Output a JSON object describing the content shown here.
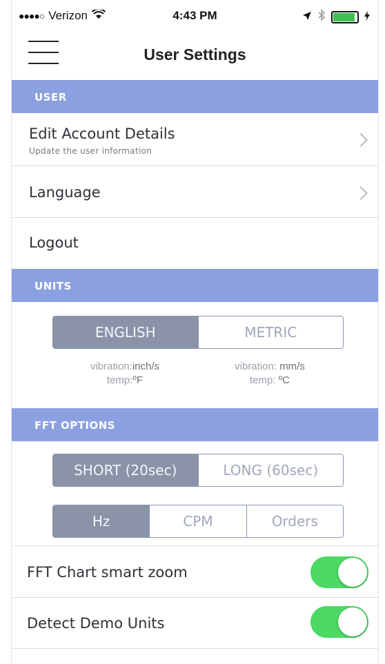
{
  "status_bar": {
    "signal": "●●●●○",
    "carrier": "Verizon",
    "wifi": "wifi-icon",
    "time": "4:43 PM",
    "location": "location-arrow-icon",
    "bluetooth": "bluetooth-icon",
    "battery_charge": 1.0
  },
  "nav": {
    "title": "User Settings",
    "menu_icon": "hamburger-menu-icon"
  },
  "sections": {
    "user": "USER",
    "units": "UNITS",
    "fft": "FFT OPTIONS"
  },
  "user_rows": {
    "edit_account": {
      "label": "Edit Account Details",
      "sub": "Update the user information"
    },
    "language": {
      "label": "Language"
    },
    "logout": {
      "label": "Logout"
    }
  },
  "units": {
    "options": [
      "ENGLISH",
      "METRIC"
    ],
    "selected": "ENGLISH",
    "english_hint": {
      "vib_label": "vibration:",
      "vib_unit": "inch/s",
      "temp_label": "temp:",
      "temp_unit": "ºF"
    },
    "metric_hint": {
      "vib_label": "vibration: ",
      "vib_unit": "mm/s",
      "temp_label": "temp: ",
      "temp_unit": "ºC"
    }
  },
  "fft": {
    "duration_options": [
      "SHORT (20sec)",
      "LONG (60sec)"
    ],
    "duration_selected": "SHORT (20sec)",
    "freq_options": [
      "Hz",
      "CPM",
      "Orders"
    ],
    "freq_selected": "Hz",
    "smart_zoom": {
      "label": "FFT Chart smart zoom",
      "on": true
    },
    "detect_demo": {
      "label": "Detect Demo Units",
      "on": true
    }
  },
  "colors": {
    "section_header": "#8ba0e0",
    "toggle_on": "#4cd964",
    "segment_active": "#8a93a8"
  }
}
